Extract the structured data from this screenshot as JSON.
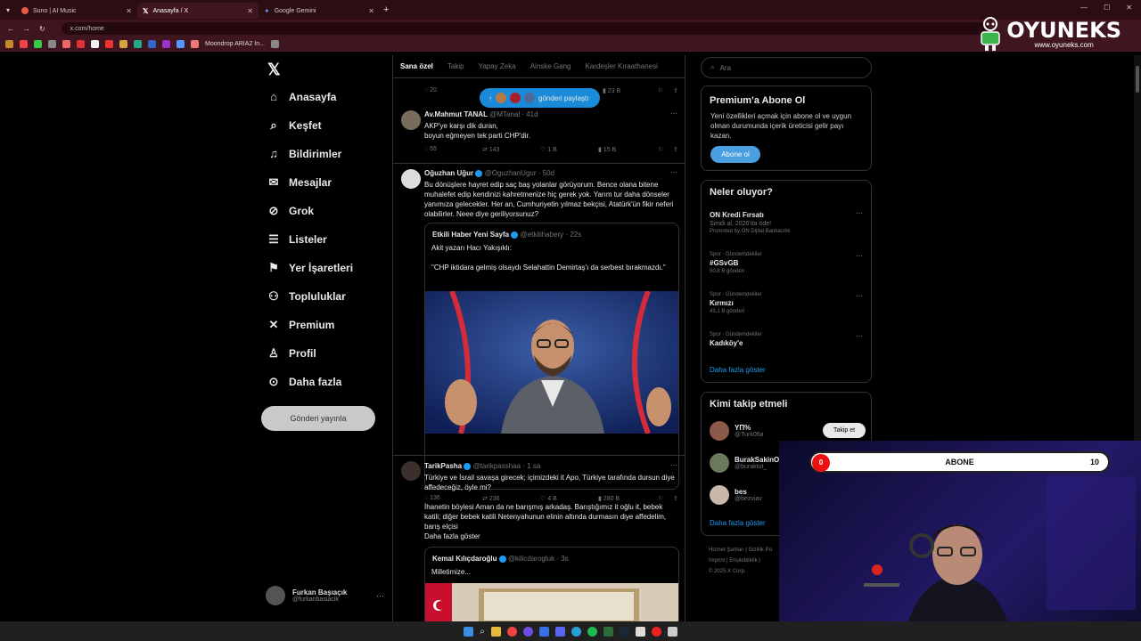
{
  "browser": {
    "tabs": [
      {
        "title": "Suno | AI Music",
        "color": "#e85d4a"
      },
      {
        "title": "Anasayfa / X",
        "color": "#ffffff"
      },
      {
        "title": "Google Gemini",
        "color": "#7b8cff"
      }
    ],
    "new_tab": "+",
    "url": "x.com/home",
    "bookmark_label": "Moondrop ARIA2 In..."
  },
  "overlay_logo": {
    "brand": "OYUNEKS",
    "site": "www.oyuneks.com"
  },
  "nav": {
    "items": [
      {
        "label": "Anasayfa",
        "icon": "home-icon",
        "glyph": "⌂"
      },
      {
        "label": "Keşfet",
        "icon": "search-icon",
        "glyph": "⌕"
      },
      {
        "label": "Bildirimler",
        "icon": "bell-icon",
        "glyph": "🔔"
      },
      {
        "label": "Mesajlar",
        "icon": "mail-icon",
        "glyph": "✉"
      },
      {
        "label": "Grok",
        "icon": "grok-icon",
        "glyph": "⊘"
      },
      {
        "label": "Listeler",
        "icon": "list-icon",
        "glyph": "☰"
      },
      {
        "label": "Yer İşaretleri",
        "icon": "bookmark-icon",
        "glyph": "⌑"
      },
      {
        "label": "Topluluklar",
        "icon": "communities-icon",
        "glyph": "👥"
      },
      {
        "label": "Premium",
        "icon": "x-premium-icon",
        "glyph": "𝕏"
      },
      {
        "label": "Profil",
        "icon": "profile-icon",
        "glyph": "👤"
      },
      {
        "label": "Daha fazla",
        "icon": "more-circle-icon",
        "glyph": "⋯"
      }
    ],
    "post_button": "Gönderi yayınla",
    "account": {
      "name": "Furkan Başıaçık",
      "handle": "@furkanbasiacik"
    }
  },
  "feed": {
    "tabs": [
      "Sana özel",
      "Takip",
      "Yapay Zeka",
      "Ainske Gang",
      "Kardeşler Kıraathanesi"
    ],
    "new_posts_pill": "gönderi paylaştı",
    "first_actions": {
      "replies": "20",
      "views": "23 B"
    },
    "posts": [
      {
        "name": "Av.Mahmut TANAL",
        "handle": "@MTanal · 41d",
        "text": [
          "AKP'ye karşı dik duran,",
          "boyun eğmeyen tek parti CHP'dir."
        ],
        "replies": "55",
        "reposts": "143",
        "likes": "1 B",
        "views": "15 B"
      },
      {
        "name": "Oğuzhan Uğur",
        "handle": "@OguzhanUgur · 50d",
        "text": [
          "Bu dönüşlere hayret edip saç baş yolanlar görüyorum. Bence olana bitene muhalefet edip kendinizi kahretmenize hiç gerek yok. Yarım tur daha dönseler yanımıza gelecekler. Her an, Cumhuriyetin yılmaz bekçisi, Atatürk'ün fikir neferi olabilirler. Neee diye geriliyorsunuz?"
        ],
        "quote": {
          "name": "Etkili Haber Yeni Sayfa",
          "handle": "@etkilihabery · 22s",
          "line1": "Akit yazarı Hacı Yakışıklı:",
          "line2": "\"CHP iktidara gelmiş olsaydı Selahattin Demirtaş'ı da serbest bırakmazdı.\""
        },
        "replies": "136",
        "reposts": "236",
        "likes": "4 B",
        "views": "280 B"
      },
      {
        "name": "TarikPasha",
        "handle": "@tarikpasshaa · 1 sa",
        "text": [
          "Türkiye ve İsrail savaşa girecek; içimizdeki it Apo, Türkiye tarafında dursun diye affedeceğiz, öyle mi?",
          "İhanetin böylesi Aman da ne barışmış arkadaş. Barıştığımız it oğlu it, bebek katili; diğer bebek katili Netenyahunun elinin altında durmasın diye affedelim, barış elçisi"
        ],
        "show_more": "Daha fazla göster",
        "quote": {
          "name": "Kemal Kılıçdaroğlu",
          "handle": "@kilicdarogluk · 3s",
          "line1": "Milletimize..."
        }
      }
    ]
  },
  "right": {
    "search_placeholder": "Ara",
    "premium": {
      "title": "Premium'a Abone Ol",
      "text": "Yeni özellikleri açmak için abone ol ve uygun olman durumunda içerik üreticisi gelir payı kazan.",
      "button": "Abone ol"
    },
    "trends_title": "Neler oluyor?",
    "trends": [
      {
        "meta": "",
        "title": "ON Kredi Fırsatı",
        "sub": "Şimdi al, 2026'da öde!",
        "count": "Promoted by ON Dijital Bankacılık"
      },
      {
        "meta": "Spor · Gündemdekiler",
        "title": "#GSvGB",
        "count": "50,8 B gönderi"
      },
      {
        "meta": "Spor · Gündemdekiler",
        "title": "Kırmızı",
        "count": "43,1 B gönderi"
      },
      {
        "meta": "Spor · Gündemdekiler",
        "title": "Kadıköy'e",
        "count": ""
      }
    ],
    "show_more": "Daha fazla göster",
    "who_title": "Kimi takip etmeli",
    "who": [
      {
        "name": "ΥΠ%",
        "handle": "@Turk06a"
      },
      {
        "name": "BurakSakinO",
        "handle": "@buraktut_"
      },
      {
        "name": "bes",
        "handle": "@bezviav"
      }
    ],
    "follow_label": "Takip et",
    "footer": [
      "Hizmet Şartları  |  Gizlilik Po",
      "Imprint  |  Erişilebilirlik  |",
      "© 2025 X Corp."
    ]
  },
  "stream_overlay": {
    "current": "0",
    "label": "ABONE",
    "goal": "10"
  },
  "colors": {
    "accent": "#1d9bf0",
    "browser_frame": "#3f1520",
    "background": "#000000"
  }
}
